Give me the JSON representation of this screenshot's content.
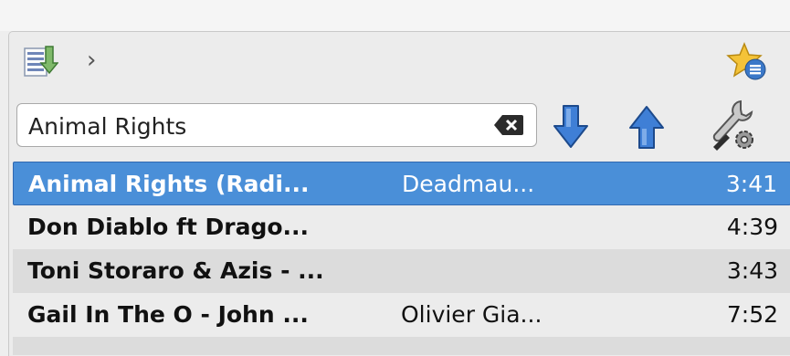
{
  "search": {
    "value": "Animal Rights",
    "placeholder": ""
  },
  "toolbar": {
    "breadcrumb_chevron": "›",
    "icons": [
      "playlist-icon",
      "chevron-right-icon",
      "favorites-star-icon",
      "clear-search-icon",
      "move-down-icon",
      "move-up-icon",
      "settings-tools-icon"
    ]
  },
  "tracks": [
    {
      "title": "Animal Rights (Radi...",
      "artist": "Deadmau...",
      "duration": "3:41",
      "selected": true
    },
    {
      "title": "Don Diablo ft Drago...",
      "artist": "",
      "duration": "4:39"
    },
    {
      "title": "Toni Storaro & Azis - ...",
      "artist": "",
      "duration": "3:43"
    },
    {
      "title": "Gail In The O - John ...",
      "artist": "Olivier Gia...",
      "duration": "7:52"
    }
  ],
  "colors": {
    "selection": "#4a8fd8",
    "arrow": "#3f7fd6",
    "alt_row": "#dcdcdc"
  }
}
